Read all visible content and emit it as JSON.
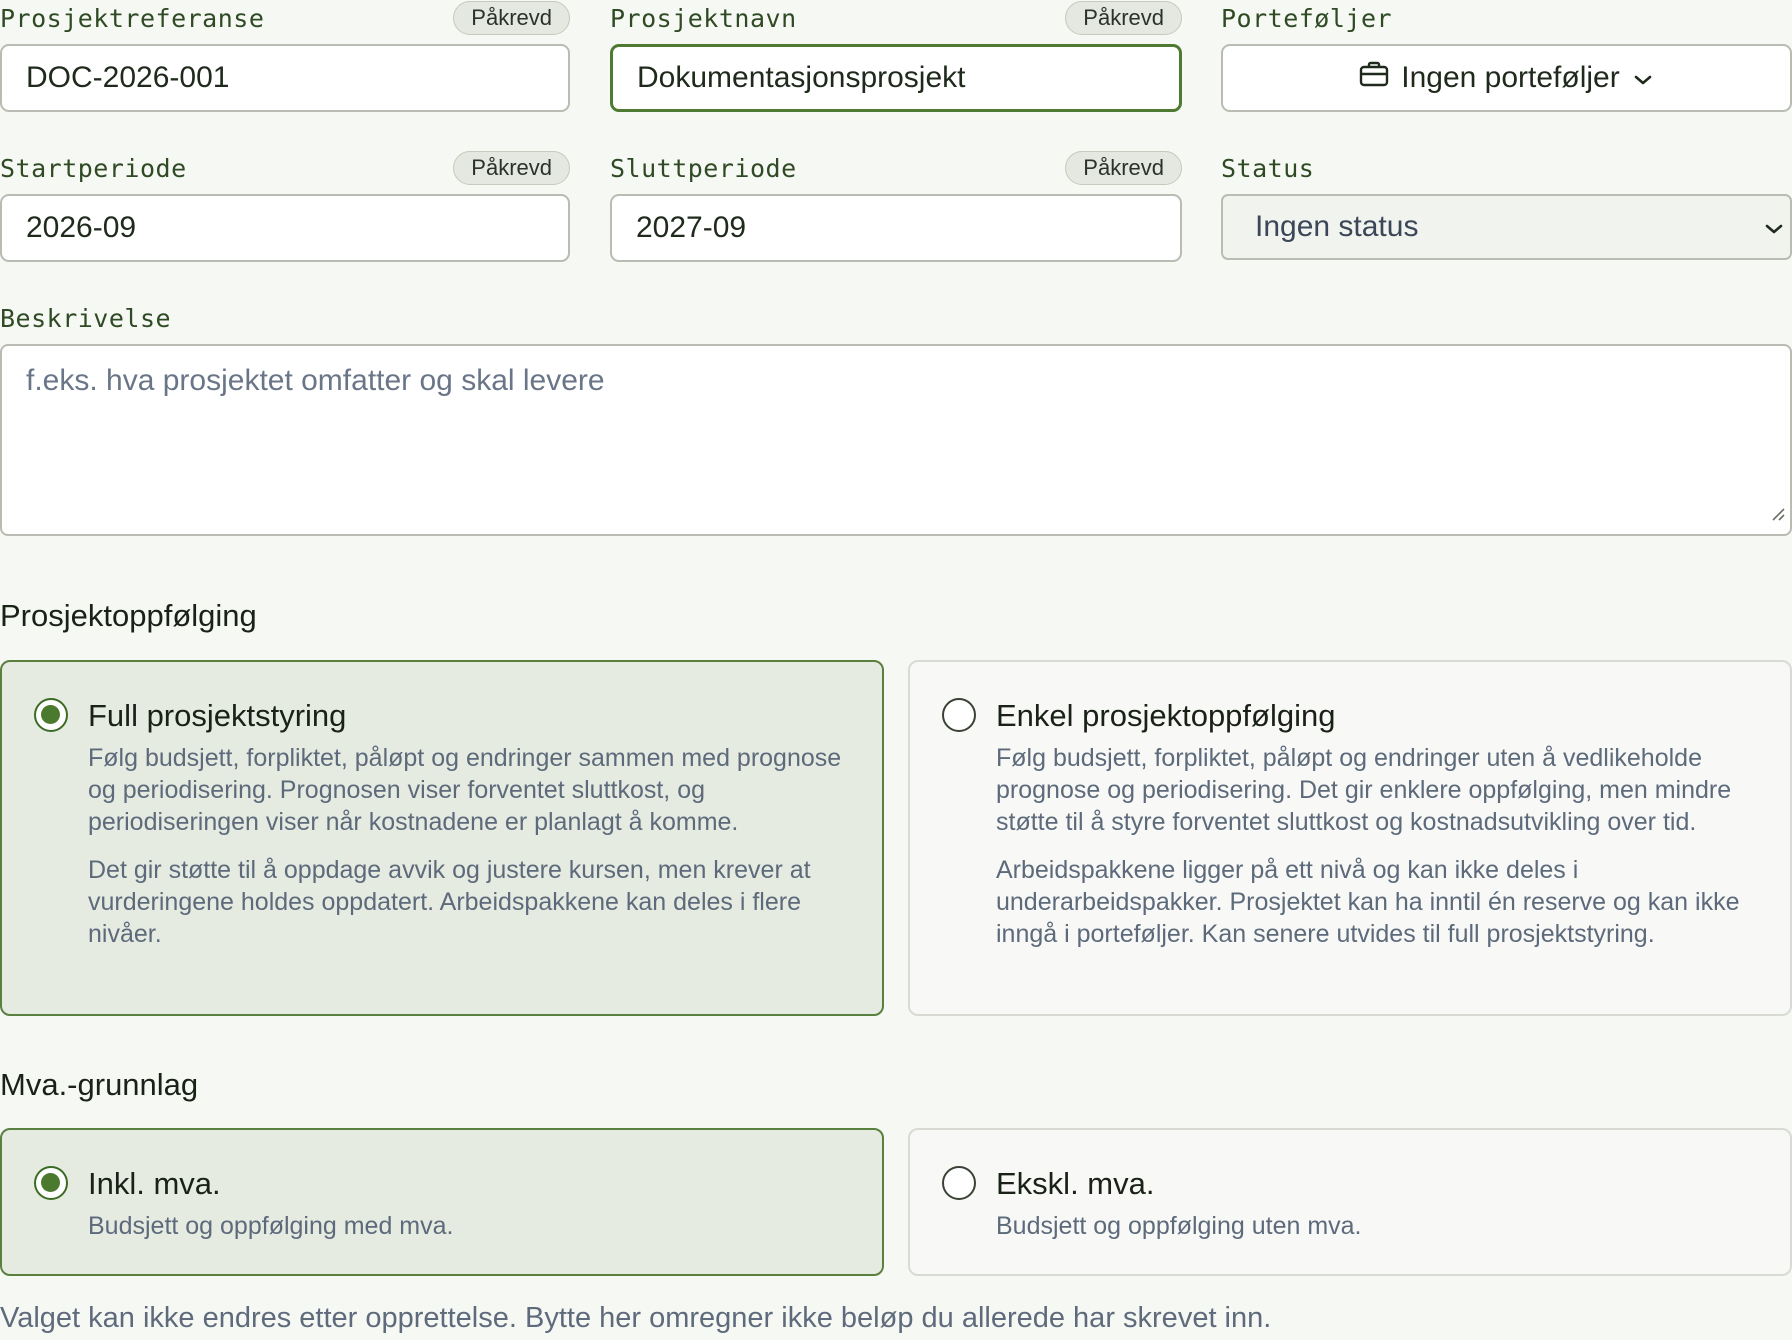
{
  "fields": {
    "reference": {
      "label": "Prosjektreferanse",
      "required": "Påkrevd",
      "value": "DOC-2026-001"
    },
    "name": {
      "label": "Prosjektnavn",
      "required": "Påkrevd",
      "value": "Dokumentasjonsprosjekt"
    },
    "portfolios": {
      "label": "Porteføljer",
      "button": "Ingen porteføljer",
      "icon": "briefcase-icon"
    },
    "start": {
      "label": "Startperiode",
      "required": "Påkrevd",
      "value": "2026-09"
    },
    "end": {
      "label": "Sluttperiode",
      "required": "Påkrevd",
      "value": "2027-09"
    },
    "status": {
      "label": "Status",
      "selected": "Ingen status"
    },
    "description": {
      "label": "Beskrivelse",
      "placeholder": "f.eks. hva prosjektet omfatter og skal levere"
    }
  },
  "followup": {
    "title": "Prosjektoppfølging",
    "options": [
      {
        "title": "Full prosjektstyring",
        "selected": true,
        "paragraphs": [
          "Følg budsjett, forpliktet, påløpt og endringer sammen med prognose og periodisering. Prognosen viser forventet sluttkost, og periodiseringen viser når kostnadene er planlagt å komme.",
          "Det gir støtte til å oppdage avvik og justere kursen, men krever at vurderingene holdes oppdatert. Arbeidspakkene kan deles i flere nivåer."
        ]
      },
      {
        "title": "Enkel prosjektoppfølging",
        "selected": false,
        "paragraphs": [
          "Følg budsjett, forpliktet, påløpt og endringer uten å vedlikeholde prognose og periodisering. Det gir enklere oppfølging, men mindre støtte til å styre forventet sluttkost og kostnadsutvikling over tid.",
          "Arbeidspakkene ligger på ett nivå og kan ikke deles i underarbeidspakker. Prosjektet kan ha inntil én reserve og kan ikke inngå i porteføljer. Kan senere utvides til full prosjektstyring."
        ]
      }
    ]
  },
  "vat": {
    "title": "Mva.-grunnlag",
    "options": [
      {
        "title": "Inkl. mva.",
        "selected": true,
        "text": "Budsjett og oppfølging med mva."
      },
      {
        "title": "Ekskl. mva.",
        "selected": false,
        "text": "Budsjett og oppfølging uten mva."
      }
    ],
    "note": "Valget kan ikke endres etter opprettelse. Bytte her omregner ikke beløp du allerede har skrevet inn."
  },
  "colors": {
    "accent": "#4f7a32",
    "selected_bg": "#e6ebe1",
    "background": "#f6f8f3"
  }
}
